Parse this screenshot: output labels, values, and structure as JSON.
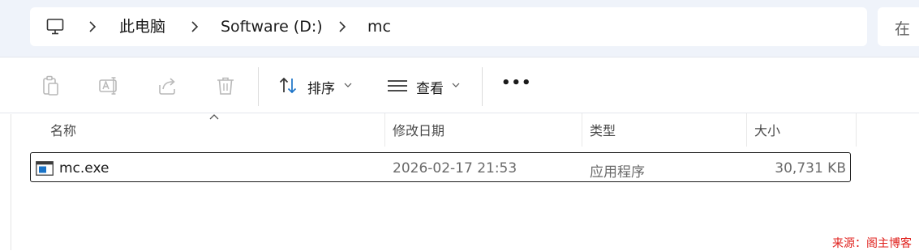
{
  "breadcrumb": {
    "items": [
      "此电脑",
      "Software (D:)",
      "mc"
    ]
  },
  "search": {
    "placeholder": "在"
  },
  "toolbar": {
    "sort_label": "排序",
    "view_label": "查看",
    "more_label": "•••"
  },
  "columns": {
    "name": "名称",
    "modified": "修改日期",
    "type": "类型",
    "size": "大小"
  },
  "files": [
    {
      "name": "mc.exe",
      "modified": "2026-02-17 21:53",
      "type": "应用程序",
      "size": "30,731 KB"
    }
  ],
  "watermark": "来源：阁主博客",
  "icons": {
    "pc": "computer-icon",
    "copy": "copy-icon",
    "rename": "rename-icon",
    "share": "share-icon",
    "delete": "delete-icon",
    "sort": "sort-icon",
    "view": "view-icon"
  },
  "colors": {
    "accent": "#1a73c7",
    "watermark": "#e0211d",
    "titlebar": "#eff3fa"
  }
}
